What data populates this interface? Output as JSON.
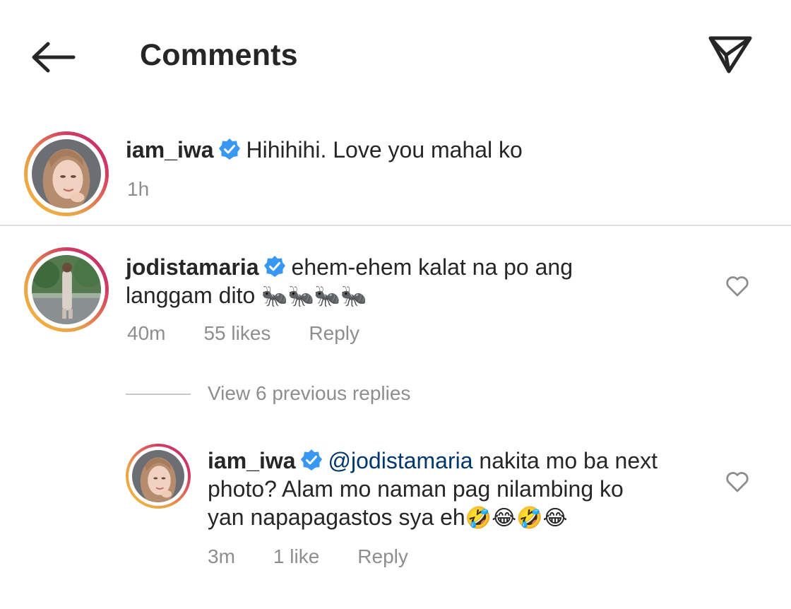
{
  "header": {
    "title": "Comments",
    "back_icon": "arrow-left-icon",
    "share_icon": "paper-plane-icon"
  },
  "caption": {
    "username": "iam_iwa",
    "text": "Hihihihi. Love you mahal ko",
    "time": "1h"
  },
  "comment": {
    "username": "jodistamaria",
    "text_line1": "ehem-ehem kalat na po ang",
    "text_line2": "langgam dito",
    "emojis": "🐜🐜🐜🐜",
    "time": "40m",
    "likes": "55 likes",
    "reply_label": "Reply"
  },
  "view_replies": "View 6 previous replies",
  "reply": {
    "username": "iam_iwa",
    "mention": "@jodistamaria",
    "text_line1_rest": "nakita mo ba next",
    "text_line2": "photo? Alam mo naman pag nilambing ko",
    "text_line3": "yan napapagastos sya eh",
    "emojis": "🤣😂🤣😂",
    "time": "3m",
    "likes": "1 like",
    "reply_label": "Reply"
  },
  "colors": {
    "text": "#262626",
    "meta": "#8e8e8e",
    "verified": "#3897f0",
    "mention": "#00376b",
    "divider": "#e0e0e0"
  }
}
